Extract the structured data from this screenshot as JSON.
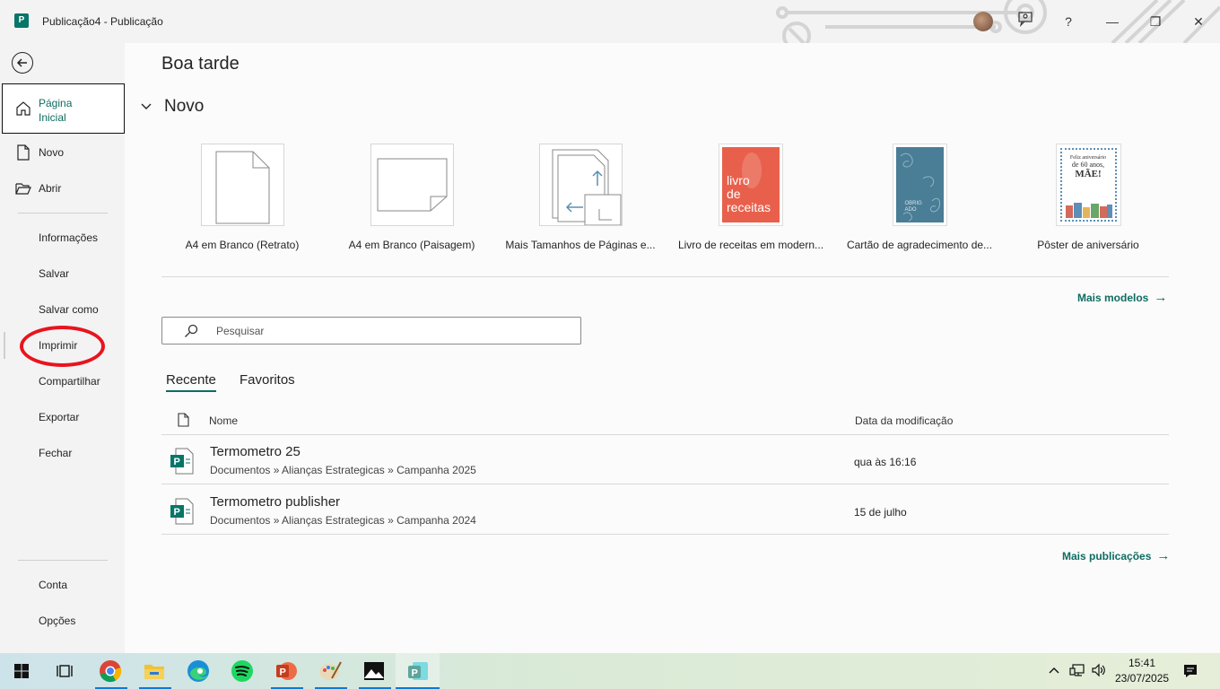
{
  "window": {
    "title": "Publicação4  -  Publicação",
    "app_letter": "P",
    "help_label": "?",
    "minimize": "—",
    "restore": "❐",
    "close": "✕"
  },
  "nav": {
    "items": [
      {
        "label": "Página Inicial",
        "icon": "home-icon"
      },
      {
        "label": "Novo",
        "icon": "new-document-icon"
      },
      {
        "label": "Abrir",
        "icon": "folder-open-icon"
      },
      {
        "label": "Informações"
      },
      {
        "label": "Salvar"
      },
      {
        "label": "Salvar como"
      },
      {
        "label": "Imprimir"
      },
      {
        "label": "Compartilhar"
      },
      {
        "label": "Exportar"
      },
      {
        "label": "Fechar"
      },
      {
        "label": "Conta"
      },
      {
        "label": "Opções"
      }
    ]
  },
  "main": {
    "greeting": "Boa tarde",
    "new_section": "Novo",
    "templates": [
      {
        "caption": "A4 em Branco (Retrato)"
      },
      {
        "caption": "A4 em Branco (Paisagem)"
      },
      {
        "caption": "Mais Tamanhos de Páginas e..."
      },
      {
        "caption": "Livro de receitas em modern...",
        "thumb_text_1": "livro",
        "thumb_text_2": "de",
        "thumb_text_3": "receitas",
        "color": "#e8604c"
      },
      {
        "caption": "Cartão de agradecimento de...",
        "thumb_text": "OBRIG ADO",
        "color": "#4a7d96"
      },
      {
        "caption": "Pôster de aniversário",
        "thumb_text_1": "Feliz aniversário",
        "thumb_text_2": "de 60 anos,",
        "thumb_text_3": "MÃE!"
      }
    ],
    "more_templates": "Mais modelos",
    "search_placeholder": "Pesquisar",
    "tabs": [
      "Recente",
      "Favoritos"
    ],
    "columns": {
      "name": "Nome",
      "modified": "Data da modificação"
    },
    "files": [
      {
        "name": "Termometro 25",
        "path": "Documentos » Alianças Estrategicas » Campanha 2025",
        "date": "qua às 16:16"
      },
      {
        "name": "Termometro publisher",
        "path": "Documentos » Alianças Estrategicas » Campanha 2024",
        "date": "15 de julho"
      }
    ],
    "more_publications": "Mais publicações"
  },
  "taskbar": {
    "time": "15:41",
    "date": "23/07/2025"
  },
  "colors": {
    "accent": "#0e6c61",
    "annotation": "#e8141e",
    "recipe_cover": "#e8604c",
    "card_cover": "#4a7d96"
  }
}
